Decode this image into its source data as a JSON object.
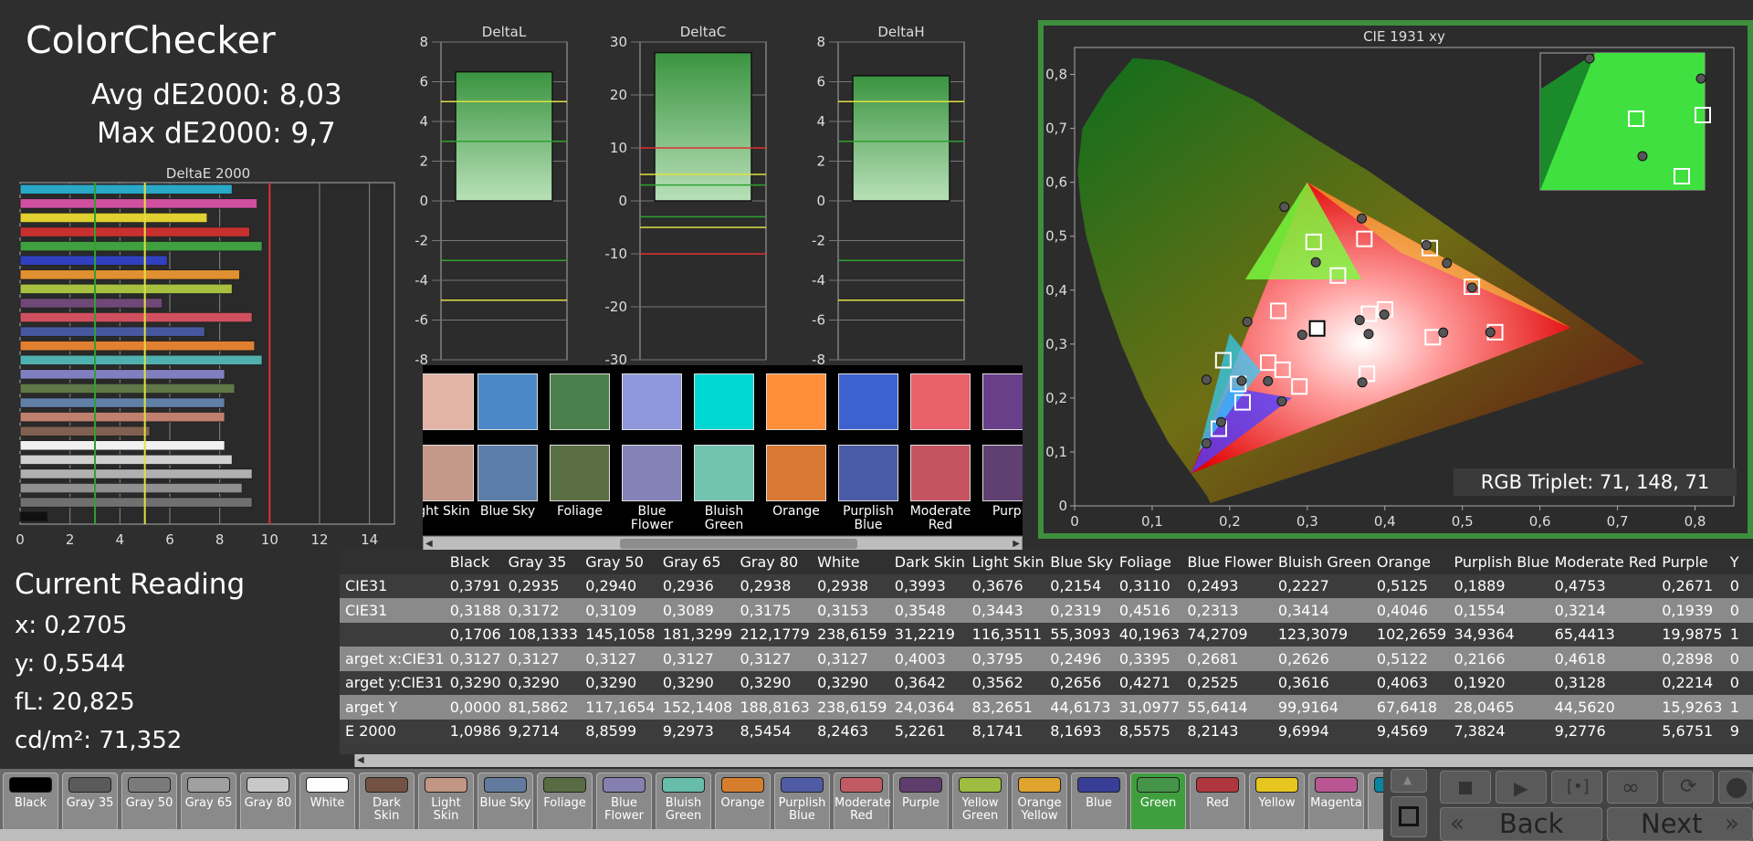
{
  "header": {
    "title": "ColorChecker",
    "avg": "Avg dE2000: 8,03",
    "max": "Max dE2000: 9,7"
  },
  "deltae_chart": {
    "title": "DeltaE 2000",
    "type": "bar",
    "xlim": [
      0,
      15
    ],
    "xticks": [
      "0",
      "2",
      "4",
      "6",
      "8",
      "10",
      "12",
      "14"
    ],
    "threshold_lines": [
      3,
      5,
      10
    ],
    "bars": [
      {
        "value": 8.5,
        "color": "#2aa8c8"
      },
      {
        "value": 9.5,
        "color": "#d050a0"
      },
      {
        "value": 7.5,
        "color": "#e0d030"
      },
      {
        "value": 9.2,
        "color": "#c83030"
      },
      {
        "value": 9.7,
        "color": "#40a040"
      },
      {
        "value": 5.9,
        "color": "#3040c0"
      },
      {
        "value": 8.8,
        "color": "#e09030"
      },
      {
        "value": 8.5,
        "color": "#a8c040"
      },
      {
        "value": 5.7,
        "color": "#704878"
      },
      {
        "value": 9.3,
        "color": "#d05060"
      },
      {
        "value": 7.4,
        "color": "#4858a0"
      },
      {
        "value": 9.4,
        "color": "#e08030"
      },
      {
        "value": 9.7,
        "color": "#50b0b0"
      },
      {
        "value": 8.2,
        "color": "#8080c0"
      },
      {
        "value": 8.6,
        "color": "#607848"
      },
      {
        "value": 8.2,
        "color": "#6080a8"
      },
      {
        "value": 8.2,
        "color": "#c08070"
      },
      {
        "value": 5.2,
        "color": "#806050"
      },
      {
        "value": 8.2,
        "color": "#f0f0f0"
      },
      {
        "value": 8.5,
        "color": "#d0d0d0"
      },
      {
        "value": 9.3,
        "color": "#b0b0b0"
      },
      {
        "value": 8.9,
        "color": "#909090"
      },
      {
        "value": 9.3,
        "color": "#707070"
      },
      {
        "value": 1.1,
        "color": "#101010"
      }
    ]
  },
  "delta_charts": [
    {
      "title": "DeltaL",
      "yticks": [
        "8",
        "6",
        "4",
        "2",
        "0",
        "-2",
        "-4",
        "-6",
        "-8"
      ],
      "ylim": [
        -8,
        8
      ],
      "value": 6.5,
      "lines": [
        {
          "v": 5,
          "c": "#e0e040"
        },
        {
          "v": 3,
          "c": "#30a030"
        },
        {
          "v": -3,
          "c": "#30a030"
        },
        {
          "v": -5,
          "c": "#e0e040"
        }
      ]
    },
    {
      "title": "DeltaC",
      "yticks": [
        "30",
        "20",
        "10",
        "0",
        "-10",
        "-20",
        "-30"
      ],
      "ylim": [
        -30,
        30
      ],
      "value": 28,
      "lines": [
        {
          "v": 10,
          "c": "#e03030"
        },
        {
          "v": 5,
          "c": "#e0e040"
        },
        {
          "v": 3,
          "c": "#30a030"
        },
        {
          "v": -3,
          "c": "#30a030"
        },
        {
          "v": -5,
          "c": "#e0e040"
        },
        {
          "v": -10,
          "c": "#e03030"
        }
      ]
    },
    {
      "title": "DeltaH",
      "yticks": [
        "8",
        "6",
        "4",
        "2",
        "0",
        "-2",
        "-4",
        "-6",
        "-8"
      ],
      "ylim": [
        -8,
        8
      ],
      "value": 6.3,
      "lines": [
        {
          "v": 5,
          "c": "#e0e040"
        },
        {
          "v": 3,
          "c": "#30a030"
        },
        {
          "v": -3,
          "c": "#30a030"
        },
        {
          "v": -5,
          "c": "#e0e040"
        }
      ]
    }
  ],
  "swatches": [
    {
      "label": "ght Skin",
      "target": "#e3b3a6",
      "actual": "#c5998a"
    },
    {
      "label": "Blue Sky",
      "target": "#4a88c8",
      "actual": "#5b7ea8"
    },
    {
      "label": "Foliage",
      "target": "#4b7f4b",
      "actual": "#5b6f45"
    },
    {
      "label": "Blue Flower",
      "target": "#8f98dc",
      "actual": "#8582b8"
    },
    {
      "label": "Bluish Green",
      "target": "#00d6d2",
      "actual": "#72c3b0"
    },
    {
      "label": "Orange",
      "target": "#ff8f38",
      "actual": "#d87832"
    },
    {
      "label": "Purplish Blue",
      "target": "#3d62d0",
      "actual": "#4c5ba6"
    },
    {
      "label": "Moderate Red",
      "target": "#e86068",
      "actual": "#c65460"
    },
    {
      "label": "Purple",
      "target": "#6a3f8a",
      "actual": "#5f4070"
    }
  ],
  "cie": {
    "title": "CIE 1931 xy",
    "xticks": [
      "0",
      "0,1",
      "0,2",
      "0,3",
      "0,4",
      "0,5",
      "0,6",
      "0,7",
      "0,8"
    ],
    "yticks": [
      "0,8",
      "0,7",
      "0,6",
      "0,5",
      "0,4",
      "0,3",
      "0,2",
      "0,1",
      "0"
    ],
    "triplet": "RGB Triplet: 71, 148, 71",
    "targets": [
      [
        0.3127,
        0.329
      ],
      [
        0.3795,
        0.3562
      ],
      [
        0.4003,
        0.3642
      ],
      [
        0.2496,
        0.2656
      ],
      [
        0.3395,
        0.4271
      ],
      [
        0.2681,
        0.2525
      ],
      [
        0.2626,
        0.3616
      ],
      [
        0.5122,
        0.4063
      ],
      [
        0.2166,
        0.192
      ],
      [
        0.4618,
        0.3128
      ],
      [
        0.2898,
        0.2214
      ],
      [
        0.3082,
        0.4895
      ],
      [
        0.3736,
        0.495
      ],
      [
        0.186,
        0.143
      ],
      [
        0.1917,
        0.27
      ],
      [
        0.377,
        0.245
      ],
      [
        0.5422,
        0.322
      ],
      [
        0.458,
        0.478
      ],
      [
        0.211,
        0.226
      ]
    ],
    "measured": [
      [
        0.2935,
        0.3172
      ],
      [
        0.3993,
        0.3548
      ],
      [
        0.3676,
        0.3443
      ],
      [
        0.2154,
        0.2319
      ],
      [
        0.311,
        0.4516
      ],
      [
        0.2493,
        0.2313
      ],
      [
        0.2227,
        0.3414
      ],
      [
        0.5125,
        0.4046
      ],
      [
        0.1889,
        0.1554
      ],
      [
        0.4753,
        0.3214
      ],
      [
        0.2671,
        0.1939
      ],
      [
        0.3703,
        0.533
      ],
      [
        0.4535,
        0.4834
      ],
      [
        0.17,
        0.116
      ],
      [
        0.17,
        0.234
      ],
      [
        0.371,
        0.229
      ],
      [
        0.536,
        0.322
      ],
      [
        0.48,
        0.45
      ],
      [
        0.2705,
        0.5544
      ],
      [
        0.3791,
        0.3188
      ]
    ]
  },
  "current": {
    "title": "Current Reading",
    "x": "x: 0,2705",
    "y": "y: 0,5544",
    "fl": "fL: 20,825",
    "cd": "cd/m²: 71,352"
  },
  "table": {
    "headers": [
      "",
      "Black",
      "Gray 35",
      "Gray 50",
      "Gray 65",
      "Gray 80",
      "White",
      "Dark Skin",
      "Light Skin",
      "Blue Sky",
      "Foliage",
      "Blue Flower",
      "Bluish Green",
      "Orange",
      "Purplish Blue",
      "Moderate Red",
      "Purple",
      "Y"
    ],
    "rows": [
      [
        "CIE31",
        "0,3791",
        "0,2935",
        "0,2940",
        "0,2936",
        "0,2938",
        "0,2938",
        "0,3993",
        "0,3676",
        "0,2154",
        "0,3110",
        "0,2493",
        "0,2227",
        "0,5125",
        "0,1889",
        "0,4753",
        "0,2671",
        "0"
      ],
      [
        "CIE31",
        "0,3188",
        "0,3172",
        "0,3109",
        "0,3089",
        "0,3175",
        "0,3153",
        "0,3548",
        "0,3443",
        "0,2319",
        "0,4516",
        "0,2313",
        "0,3414",
        "0,4046",
        "0,1554",
        "0,3214",
        "0,1939",
        "0"
      ],
      [
        "",
        "0,1706",
        "108,1333",
        "145,1058",
        "181,3299",
        "212,1779",
        "238,6159",
        "31,2219",
        "116,3511",
        "55,3093",
        "40,1963",
        "74,2709",
        "123,3079",
        "102,2659",
        "34,9364",
        "65,4413",
        "19,9875",
        "1"
      ],
      [
        "arget x:CIE31",
        "0,3127",
        "0,3127",
        "0,3127",
        "0,3127",
        "0,3127",
        "0,3127",
        "0,4003",
        "0,3795",
        "0,2496",
        "0,3395",
        "0,2681",
        "0,2626",
        "0,5122",
        "0,2166",
        "0,4618",
        "0,2898",
        "0"
      ],
      [
        "arget y:CIE31",
        "0,3290",
        "0,3290",
        "0,3290",
        "0,3290",
        "0,3290",
        "0,3290",
        "0,3642",
        "0,3562",
        "0,2656",
        "0,4271",
        "0,2525",
        "0,3616",
        "0,4063",
        "0,1920",
        "0,3128",
        "0,2214",
        "0"
      ],
      [
        "arget Y",
        "0,0000",
        "81,5862",
        "117,1654",
        "152,1408",
        "188,8163",
        "238,6159",
        "24,0364",
        "83,2651",
        "44,6173",
        "31,0977",
        "55,6414",
        "99,9164",
        "67,6418",
        "28,0465",
        "44,5620",
        "15,9263",
        "1"
      ],
      [
        "E 2000",
        "1,0986",
        "9,2714",
        "8,8599",
        "9,2973",
        "8,5454",
        "8,2463",
        "5,2261",
        "8,1741",
        "8,1693",
        "8,5575",
        "8,2143",
        "9,6994",
        "9,4569",
        "7,3824",
        "9,2776",
        "5,6751",
        "9"
      ]
    ]
  },
  "patches": [
    {
      "label": "Black",
      "color": "#000000"
    },
    {
      "label": "Gray 35",
      "color": "#5a5a5a"
    },
    {
      "label": "Gray 50",
      "color": "#7b7b7b"
    },
    {
      "label": "Gray 65",
      "color": "#a0a0a0"
    },
    {
      "label": "Gray 80",
      "color": "#c8c8c8"
    },
    {
      "label": "White",
      "color": "#ffffff"
    },
    {
      "label": "Dark Skin",
      "color": "#735244"
    },
    {
      "label": "Light Skin",
      "color": "#c29682"
    },
    {
      "label": "Blue Sky",
      "color": "#627a9d"
    },
    {
      "label": "Foliage",
      "color": "#576c43"
    },
    {
      "label": "Blue Flower",
      "color": "#8580b1"
    },
    {
      "label": "Bluish Green",
      "color": "#67bdaa"
    },
    {
      "label": "Orange",
      "color": "#d67e2c"
    },
    {
      "label": "Purplish Blue",
      "color": "#505ba6"
    },
    {
      "label": "Moderate Red",
      "color": "#c15a63"
    },
    {
      "label": "Purple",
      "color": "#5e3c6c"
    },
    {
      "label": "Yellow Green",
      "color": "#9dbc40"
    },
    {
      "label": "Orange Yellow",
      "color": "#e0a32e"
    },
    {
      "label": "Blue",
      "color": "#383d96"
    },
    {
      "label": "Green",
      "color": "#469449"
    },
    {
      "label": "Red",
      "color": "#af363c"
    },
    {
      "label": "Yellow",
      "color": "#e7c71f"
    },
    {
      "label": "Magenta",
      "color": "#bb5695"
    },
    {
      "label": "",
      "color": "#0885a1"
    }
  ],
  "nav": {
    "back": "Back",
    "next": "Next"
  }
}
